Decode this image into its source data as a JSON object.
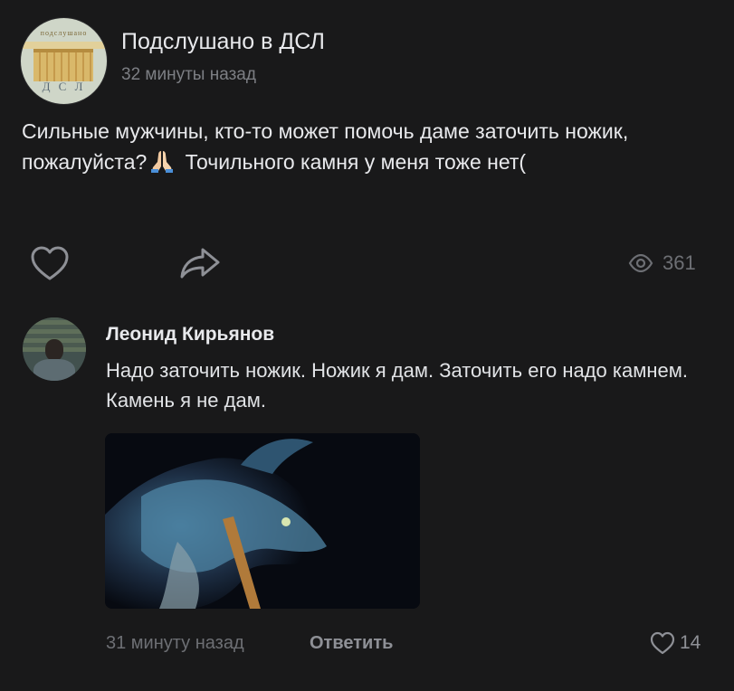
{
  "post": {
    "group_avatar": {
      "top_text": "подслушано",
      "lettering": "Д С Л"
    },
    "group_name": "Подслушано в ДСЛ",
    "time": "32 минуты назад",
    "text_before_emoji": "Сильные мужчины, кто-то может помочь даме заточить ножик, пожалуйста?",
    "emoji": "folded-hands",
    "text_after_emoji": " Точильного камня у меня тоже нет(",
    "views": "361"
  },
  "comment": {
    "author": "Леонид Кирьянов",
    "text": "Надо заточить ножик. Ножик я дам. Заточить его надо камнем. Камень я не дам.",
    "time": "31 минуту назад",
    "reply_label": "Ответить",
    "likes": "14",
    "media": "dragon-gif-thumbnail"
  },
  "colors": {
    "background": "#19191a",
    "primary_text": "#e8e9ec",
    "secondary_text": "#6d6f74"
  }
}
